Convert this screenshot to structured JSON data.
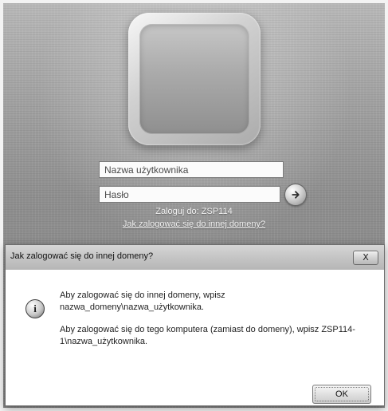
{
  "login": {
    "avatar_icon": "user-tile",
    "username_placeholder": "Nazwa użytkownika",
    "password_placeholder": "Hasło",
    "submit_icon": "arrow-right-icon",
    "login_to_text": "Zaloguj do: ZSP114",
    "other_domain_link": "Jak zalogować się do innej domeny?"
  },
  "dialog": {
    "title": "Jak zalogować się do innej domeny?",
    "close_label": "X",
    "info_icon": "info-icon",
    "message_1": "Aby zalogować się do innej domeny, wpisz nazwa_domeny\\nazwa_użytkownika.",
    "message_2": "Aby zalogować się do tego komputera (zamiast do domeny), wpisz ZSP114-1\\nazwa_użytkownika.",
    "ok_label": "OK"
  }
}
